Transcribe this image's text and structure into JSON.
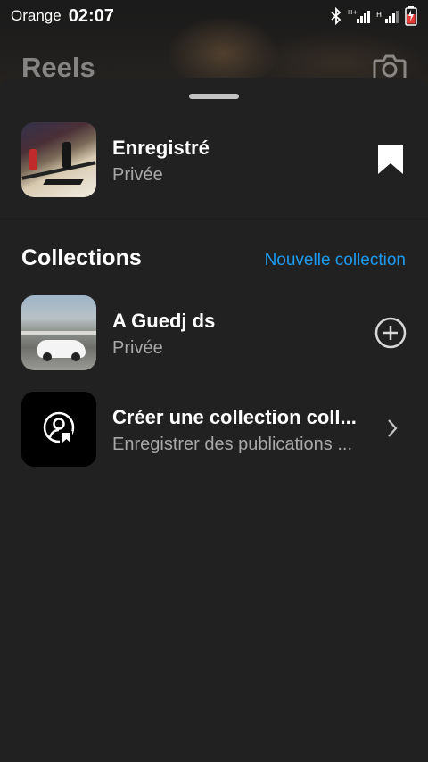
{
  "status_bar": {
    "carrier": "Orange",
    "time": "02:07"
  },
  "background": {
    "title": "Reels"
  },
  "sheet": {
    "saved": {
      "title": "Enregistré",
      "subtitle": "Privée"
    },
    "collections_header": {
      "title": "Collections",
      "new_collection_label": "Nouvelle collection"
    },
    "collections": [
      {
        "title": "A Guedj ds",
        "subtitle": "Privée"
      }
    ],
    "create_shared": {
      "title": "Créer une collection coll...",
      "subtitle": "Enregistrer des publications ..."
    }
  },
  "colors": {
    "accent": "#1d9bf0",
    "sheet_bg": "#212121",
    "subtext": "#a8a8a8"
  }
}
